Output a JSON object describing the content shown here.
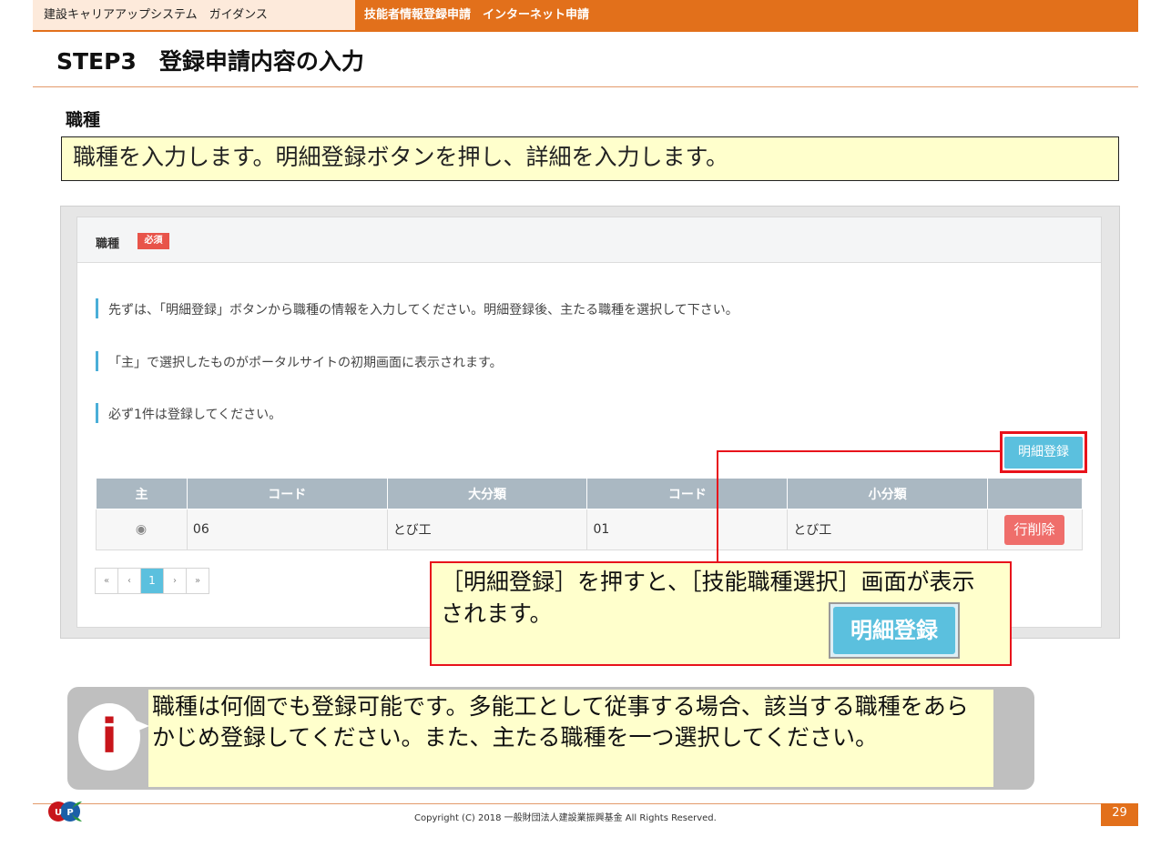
{
  "header": {
    "doc_title": "建設キャリアアップシステム　ガイダンス",
    "section_title": "技能者情報登録申請　インターネット申請",
    "accent_color": "#e2701b"
  },
  "page": {
    "step_title": "STEP3　登録申請内容の入力",
    "section_label": "職種",
    "intro": "職種を入力します。明細登録ボタンを押し、詳細を入力します。"
  },
  "panel": {
    "title": "職種",
    "required_badge": "必須",
    "notes": [
      "先ずは、「明細登録」ボタンから職種の情報を入力してください。明細登録後、主たる職種を選択して下さい。",
      "「主」で選択したものがポータルサイトの初期画面に表示されます。",
      "必ず1件は登録してください。"
    ],
    "detail_button": "明細登録",
    "table": {
      "headers": [
        "主",
        "コード",
        "大分類",
        "コード",
        "小分類",
        ""
      ],
      "rows": [
        {
          "radio": "◉",
          "code1": "06",
          "major": "とび工",
          "code2": "01",
          "minor": "とび工",
          "action": "行削除"
        }
      ]
    },
    "pager": {
      "first": "«",
      "prev": "‹",
      "current": "1",
      "next": "›",
      "last": "»"
    }
  },
  "callout": {
    "text": "［明細登録］を押すと、［技能職種選択］画面が表示されます。",
    "button_label": "明細登録"
  },
  "info": {
    "icon": "i",
    "text": "職種は何個でも登録可能です。多能工として従事する場合、該当する職種をあらかじめ登録してください。また、主たる職種を一つ選択してください。"
  },
  "footer": {
    "logo_text": "UPC",
    "copyright": "Copyright (C) 2018 一般財団法人建設業振興基金 All Rights Reserved.",
    "page_number": "29"
  }
}
